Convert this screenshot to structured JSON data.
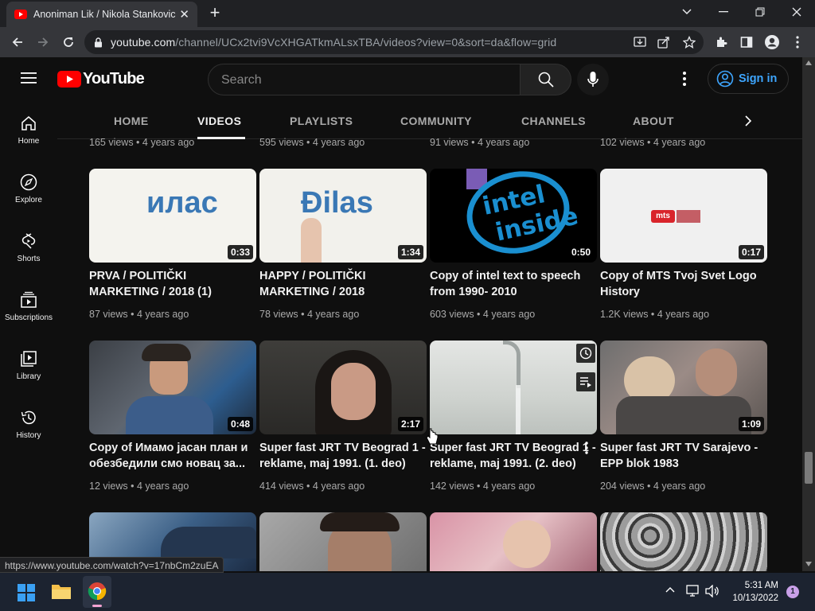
{
  "browser": {
    "tab_title": "Anoniman Lik / Nikola Stankovic",
    "url_host": "youtube.com",
    "url_path": "/channel/UCx2tvi9VcXHGATkmALsxTBA/videos?view=0&sort=da&flow=grid",
    "status_url": "https://www.youtube.com/watch?v=17nbCm2zuEA"
  },
  "youtube": {
    "logo_text": "YouTube",
    "search_placeholder": "Search",
    "sign_in": "Sign in"
  },
  "sidebar": [
    {
      "label": "Home"
    },
    {
      "label": "Explore"
    },
    {
      "label": "Shorts"
    },
    {
      "label": "Subscriptions"
    },
    {
      "label": "Library"
    },
    {
      "label": "History"
    }
  ],
  "channel_tabs": [
    "HOME",
    "VIDEOS",
    "PLAYLISTS",
    "COMMUNITY",
    "CHANNELS",
    "ABOUT"
  ],
  "top_row_meta": [
    "165 views • 4 years ago",
    "595 views • 4 years ago",
    "91 views • 4 years ago",
    "102 views • 4 years ago"
  ],
  "row1": [
    {
      "title": "PRVA / POLITIČKI MARKETING / 2018 (1)",
      "meta": "87 views • 4 years ago",
      "duration": "0:33",
      "thumb_text": "илас"
    },
    {
      "title": "HAPPY / POLITIČKI MARKETING / 2018",
      "meta": "78 views • 4 years ago",
      "duration": "1:34",
      "thumb_text": "Đilas"
    },
    {
      "title": "Copy of intel text to speech from 1990- 2010",
      "meta": "603 views • 4 years ago",
      "duration": "0:50",
      "thumb_text_1": "intel",
      "thumb_text_2": "inside"
    },
    {
      "title": "Copy of MTS Tvoj Svet Logo History",
      "meta": "1.2K views • 4 years ago",
      "duration": "0:17",
      "thumb_text": "mts"
    }
  ],
  "row2": [
    {
      "title": "Copy of Имамо јасан план и обезбедили смо новац за...",
      "meta": "12 views • 4 years ago",
      "duration": "0:48"
    },
    {
      "title": "Super fast JRT TV Beograd 1 - reklame, maj 1991. (1. deo)",
      "meta": "414 views • 4 years ago",
      "duration": "2:17"
    },
    {
      "title": "Super fast JRT TV Beograd 1 - reklame, maj 1991. (2. deo)",
      "meta": "142 views • 4 years ago",
      "duration": ""
    },
    {
      "title": "Super fast JRT TV Sarajevo - EPP blok 1983",
      "meta": "204 views • 4 years ago",
      "duration": "1:09"
    }
  ],
  "taskbar": {
    "time": "5:31 AM",
    "date": "10/13/2022",
    "notification_count": "1"
  },
  "colors": {
    "accent_red": "#ff0000",
    "link_blue": "#3ea6ff",
    "bg": "#0f0f0f"
  }
}
